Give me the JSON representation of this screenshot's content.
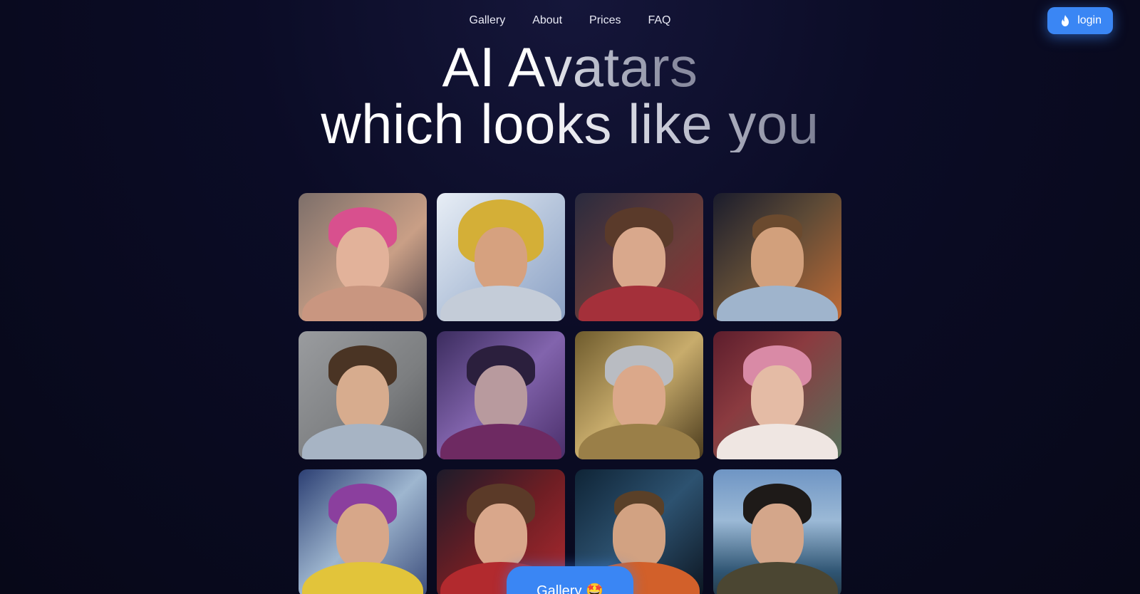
{
  "nav": {
    "links": [
      {
        "label": "Gallery"
      },
      {
        "label": "About"
      },
      {
        "label": "Prices"
      },
      {
        "label": "FAQ"
      }
    ],
    "login_label": "login",
    "login_icon": "flame-icon",
    "accent_color": "#3a86f4"
  },
  "hero": {
    "line1": "AI Avatars",
    "line2": "which looks like you"
  },
  "gallery": {
    "tiles": [
      {
        "name": "pink-hair-woman"
      },
      {
        "name": "knight-helmet-man"
      },
      {
        "name": "red-top-woman"
      },
      {
        "name": "astronaut-man"
      },
      {
        "name": "bearded-man"
      },
      {
        "name": "forest-woman"
      },
      {
        "name": "silver-hair-woman"
      },
      {
        "name": "pink-hair-girl"
      },
      {
        "name": "camera-woman"
      },
      {
        "name": "red-armor-woman"
      },
      {
        "name": "space-suit-man"
      },
      {
        "name": "sunglasses-man"
      }
    ],
    "button_label": "Gallery 🤩"
  }
}
